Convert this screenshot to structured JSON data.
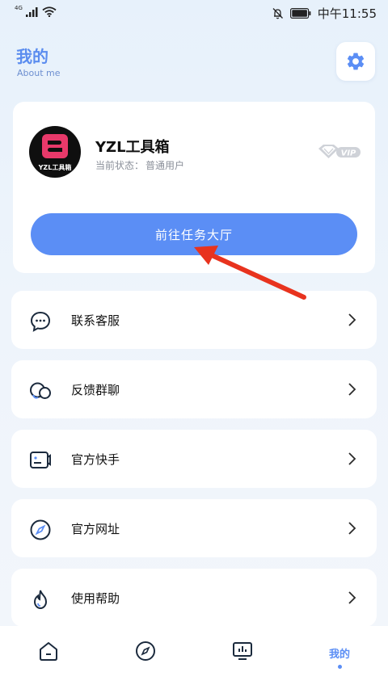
{
  "status_bar": {
    "network": "4G",
    "time": "中午11:55"
  },
  "header": {
    "title": "我的",
    "subtitle": "About me"
  },
  "profile": {
    "avatar_text": "YZL工具箱",
    "name": "YZL工具箱",
    "status_label": "当前状态：",
    "status_value": "普通用户",
    "badge": "VIP"
  },
  "task_button": {
    "label": "前往任务大厅"
  },
  "menu": [
    {
      "label": "联系客服",
      "icon": "chat-icon"
    },
    {
      "label": "反馈群聊",
      "icon": "group-chat-icon"
    },
    {
      "label": "官方快手",
      "icon": "video-icon"
    },
    {
      "label": "官方网址",
      "icon": "compass-icon"
    },
    {
      "label": "使用帮助",
      "icon": "flame-icon"
    }
  ],
  "bottom_nav": [
    {
      "icon": "home-icon"
    },
    {
      "icon": "compass-icon"
    },
    {
      "icon": "dashboard-icon"
    },
    {
      "label": "我的",
      "active": true
    }
  ],
  "colors": {
    "accent": "#5b8ef5",
    "annotation": "#e8331e"
  }
}
